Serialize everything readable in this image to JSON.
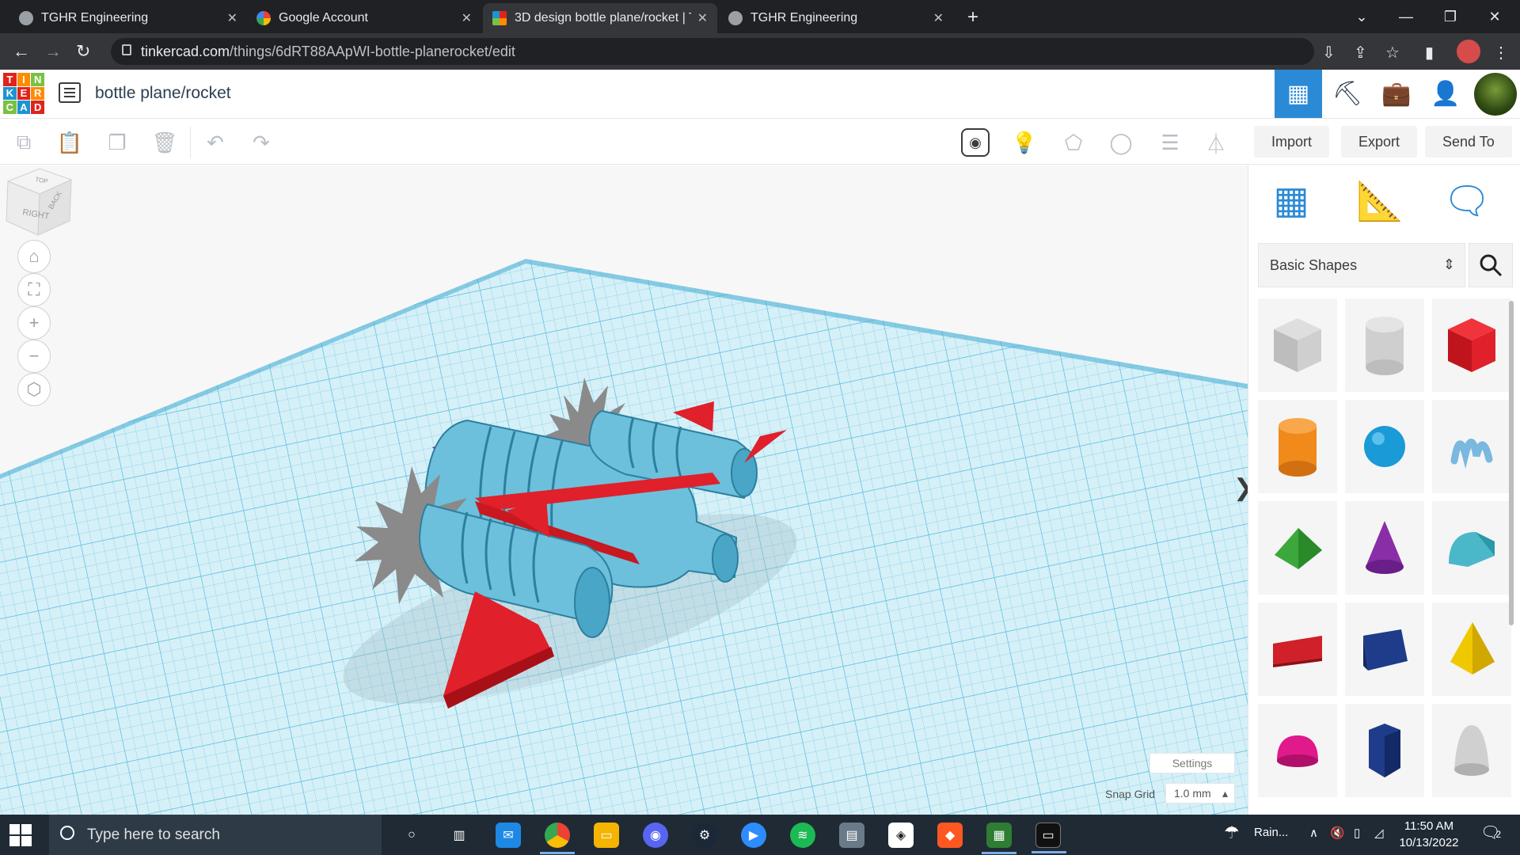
{
  "browser": {
    "tabs": [
      {
        "title": "TGHR Engineering",
        "icon": "globe-icon",
        "active": false
      },
      {
        "title": "Google Account",
        "icon": "google-icon",
        "active": false
      },
      {
        "title": "3D design bottle plane/rocket | T",
        "icon": "tinkercad-icon",
        "active": true
      },
      {
        "title": "TGHR Engineering",
        "icon": "globe-icon",
        "active": false
      }
    ],
    "close_glyph": "✕",
    "new_tab_glyph": "+",
    "url_host": "tinkercad.com",
    "url_path": "/things/6dRT88AApWI-bottle-planerocket/edit"
  },
  "header": {
    "logo_letters": [
      "T",
      "I",
      "N",
      "K",
      "E",
      "R",
      "C",
      "A",
      "D"
    ],
    "logo_colors": [
      "#e2231a",
      "#ff8c00",
      "#7ac142",
      "#1c94d2",
      "#e2231a",
      "#ff8c00",
      "#7ac142",
      "#1c94d2",
      "#e2231a"
    ],
    "design_title": "bottle plane/rocket"
  },
  "toolbar": {
    "import_label": "Import",
    "export_label": "Export",
    "send_to_label": "Send To"
  },
  "workplane": {
    "viewcube_faces": {
      "right": "RIGHT",
      "back": "BACK",
      "top": "TOP"
    },
    "settings_label": "Settings",
    "snap_grid_label": "Snap Grid",
    "snap_grid_value": "1.0 mm",
    "snap_grid_arrow": "▴",
    "grid_color": "#7ecfe8",
    "model_body_color": "#6cc0dc",
    "wing_color": "#e0202a"
  },
  "shapes_panel": {
    "category": "Basic Shapes",
    "shapes": [
      {
        "name": "box-hole",
        "color": "#c9c9c9"
      },
      {
        "name": "cylinder-hole",
        "color": "#c9c9c9"
      },
      {
        "name": "box",
        "color": "#e0202a"
      },
      {
        "name": "cylinder",
        "color": "#f08a1a"
      },
      {
        "name": "sphere",
        "color": "#1a9ad6"
      },
      {
        "name": "scribble",
        "color": "#7ab8e0"
      },
      {
        "name": "roof",
        "color": "#3ca83c"
      },
      {
        "name": "cone",
        "color": "#8a2ea8"
      },
      {
        "name": "round-roof",
        "color": "#4ab8c8"
      },
      {
        "name": "text",
        "color": "#d0202a"
      },
      {
        "name": "wedge-box",
        "color": "#1e3c8a"
      },
      {
        "name": "pyramid",
        "color": "#f0c800"
      },
      {
        "name": "half-sphere",
        "color": "#e01a8a"
      },
      {
        "name": "polygon",
        "color": "#1e3c8a"
      },
      {
        "name": "paraboloid",
        "color": "#c9c9c9"
      }
    ]
  },
  "taskbar": {
    "search_placeholder": "Type here to search",
    "weather": "Rain...",
    "time": "11:50 AM",
    "date": "10/13/2022",
    "notifications": "2"
  }
}
